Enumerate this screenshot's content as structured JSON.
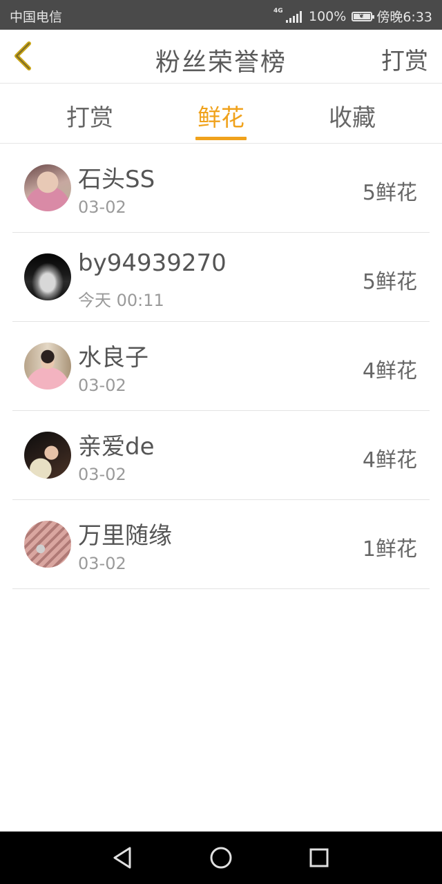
{
  "status_bar": {
    "carrier": "中国电信",
    "network_type": "4G",
    "battery_percent": "100%",
    "time": "傍晚6:33",
    "battery_level": 1.0,
    "icons": [
      "signal-icon",
      "battery-icon"
    ]
  },
  "header": {
    "title": "粉丝荣誉榜",
    "action_label": "打赏",
    "back_icon": "chevron-left-icon",
    "back_icon_color": "#c9a516"
  },
  "tabs": [
    {
      "label": "打赏",
      "active": false
    },
    {
      "label": "鲜花",
      "active": true
    },
    {
      "label": "收藏",
      "active": false
    }
  ],
  "accent_color": "#f0a21c",
  "fans": [
    {
      "name": "石头SS",
      "date": "03-02",
      "amount": "5鲜花",
      "avatar": "avatar-girl-pink"
    },
    {
      "name": "by94939270",
      "date": "今天 00:11",
      "amount": "5鲜花",
      "avatar": "avatar-car"
    },
    {
      "name": "水良子",
      "date": "03-02",
      "amount": "4鲜花",
      "avatar": "avatar-boy-pink-shirt"
    },
    {
      "name": "亲爱de",
      "date": "03-02",
      "amount": "4鲜花",
      "avatar": "avatar-woman-dark"
    },
    {
      "name": "万里随缘",
      "date": "03-02",
      "amount": "1鲜花",
      "avatar": "avatar-anime"
    }
  ],
  "nav_bar": {
    "icons": [
      "back-triangle-icon",
      "home-circle-icon",
      "recents-square-icon"
    ]
  }
}
